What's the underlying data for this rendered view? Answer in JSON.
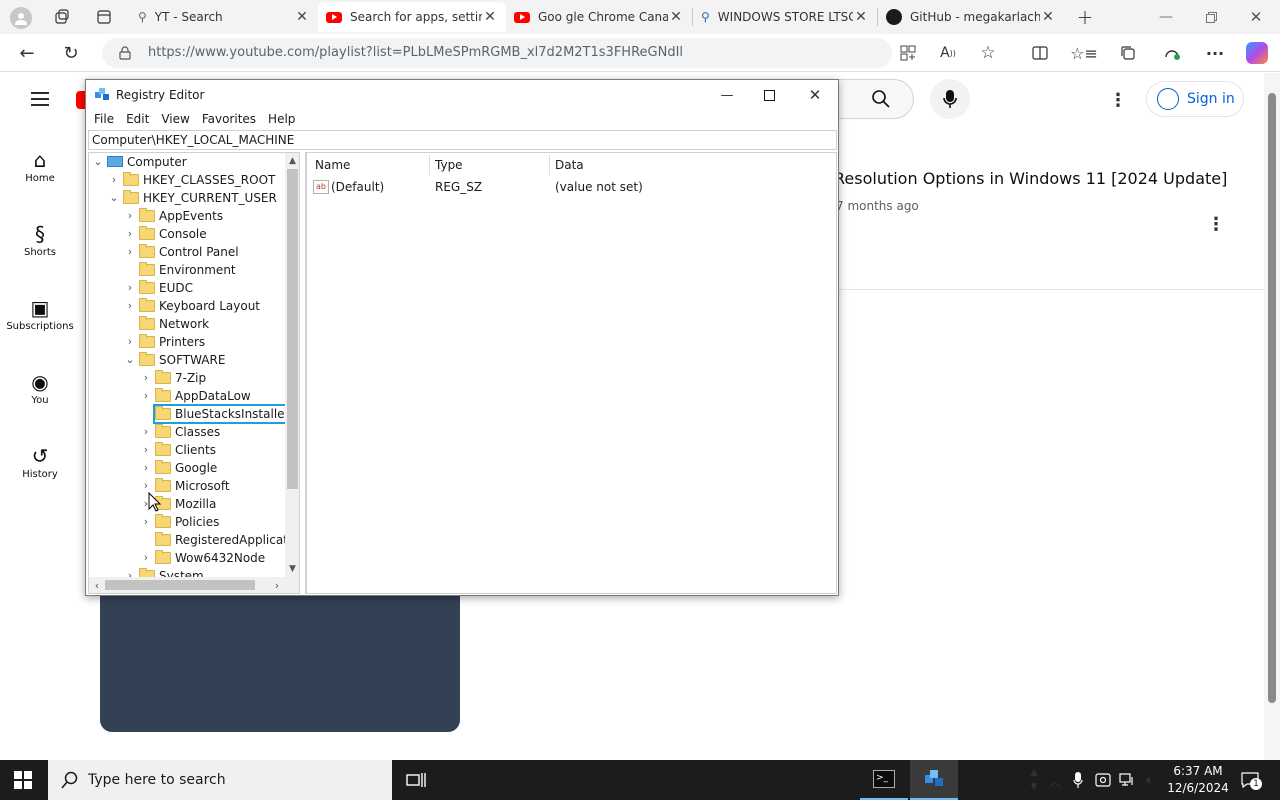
{
  "browser": {
    "tabs": [
      {
        "title": "YT - Search",
        "icon": "search-icon"
      },
      {
        "title": "Search for apps, setting",
        "icon": "youtube-icon"
      },
      {
        "title": "Goo gle Chrome Canar",
        "icon": "youtube-icon"
      },
      {
        "title": "WINDOWS STORE LTSC",
        "icon": "search-icon"
      },
      {
        "title": "GitHub - megakarlach/",
        "icon": "github-icon"
      }
    ],
    "url": "https://www.youtube.com/playlist?list=PLbLMeSPmRGMB_xl7d2M2T1s3FHReGNdIl"
  },
  "youtube": {
    "sidebar": [
      {
        "label": "Home",
        "icon": "home-icon"
      },
      {
        "label": "Shorts",
        "icon": "shorts-icon"
      },
      {
        "label": "Subscriptions",
        "icon": "subscriptions-icon"
      },
      {
        "label": "You",
        "icon": "you-icon"
      },
      {
        "label": "History",
        "icon": "history-icon"
      }
    ],
    "sign_in": "Sign in",
    "video_title": "Resolution Options in Windows 11 [2024 Update]",
    "video_meta": "7 months ago"
  },
  "regedit": {
    "title": "Registry Editor",
    "menu": [
      "File",
      "Edit",
      "View",
      "Favorites",
      "Help"
    ],
    "address": "Computer\\HKEY_LOCAL_MACHINE",
    "tree": [
      {
        "label": "Computer",
        "level": 0,
        "expand": "open",
        "type": "computer"
      },
      {
        "label": "HKEY_CLASSES_ROOT",
        "level": 1,
        "expand": "closed"
      },
      {
        "label": "HKEY_CURRENT_USER",
        "level": 1,
        "expand": "open"
      },
      {
        "label": "AppEvents",
        "level": 2,
        "expand": "closed"
      },
      {
        "label": "Console",
        "level": 2,
        "expand": "closed"
      },
      {
        "label": "Control Panel",
        "level": 2,
        "expand": "closed"
      },
      {
        "label": "Environment",
        "level": 2,
        "expand": "none"
      },
      {
        "label": "EUDC",
        "level": 2,
        "expand": "closed"
      },
      {
        "label": "Keyboard Layout",
        "level": 2,
        "expand": "closed"
      },
      {
        "label": "Network",
        "level": 2,
        "expand": "none"
      },
      {
        "label": "Printers",
        "level": 2,
        "expand": "closed"
      },
      {
        "label": "SOFTWARE",
        "level": 2,
        "expand": "open"
      },
      {
        "label": "7-Zip",
        "level": 3,
        "expand": "closed"
      },
      {
        "label": "AppDataLow",
        "level": 3,
        "expand": "closed"
      },
      {
        "label": "BlueStacksInstaller",
        "level": 3,
        "expand": "none",
        "highlighted": true
      },
      {
        "label": "Classes",
        "level": 3,
        "expand": "closed"
      },
      {
        "label": "Clients",
        "level": 3,
        "expand": "closed"
      },
      {
        "label": "Google",
        "level": 3,
        "expand": "closed"
      },
      {
        "label": "Microsoft",
        "level": 3,
        "expand": "closed"
      },
      {
        "label": "Mozilla",
        "level": 3,
        "expand": "closed"
      },
      {
        "label": "Policies",
        "level": 3,
        "expand": "closed"
      },
      {
        "label": "RegisteredApplicatic",
        "level": 3,
        "expand": "none"
      },
      {
        "label": "Wow6432Node",
        "level": 3,
        "expand": "closed"
      },
      {
        "label": "System",
        "level": 2,
        "expand": "closed"
      }
    ],
    "columns": [
      "Name",
      "Type",
      "Data"
    ],
    "values": [
      {
        "name": "(Default)",
        "type": "REG_SZ",
        "data": "(value not set)"
      }
    ]
  },
  "taskbar": {
    "search_placeholder": "Type here to search",
    "time": "6:37 AM",
    "date": "12/6/2024",
    "notification_count": "1"
  },
  "colors": {
    "highlight": "#1ba1e2",
    "youtube_red": "#ff0000",
    "thumbnail": "#334155"
  }
}
